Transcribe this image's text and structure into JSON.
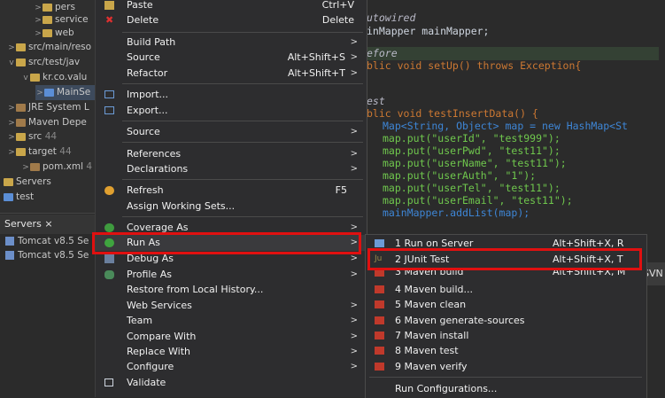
{
  "explorer": {
    "rows": [
      {
        "label": "pers",
        "prefix": ">"
      },
      {
        "label": "service",
        "prefix": ">"
      },
      {
        "label": "web",
        "prefix": ">"
      },
      {
        "label": "src/main/reso",
        "prefix": ">"
      },
      {
        "label": "src/test/jav",
        "prefix": "v"
      },
      {
        "label": "kr.co.valu",
        "prefix": "v"
      },
      {
        "label": "MainSe",
        "prefix": ">"
      },
      {
        "label": "JRE System L",
        "prefix": ">"
      },
      {
        "label": "Maven Depe",
        "prefix": ">"
      },
      {
        "label": "src",
        "prefix": ">",
        "suffix": "44"
      },
      {
        "label": "target",
        "prefix": ">",
        "suffix": "44"
      },
      {
        "label": "pom.xml",
        "prefix": ">",
        "suffix": "4"
      },
      {
        "label": "Servers",
        "prefix": ""
      },
      {
        "label": "test",
        "prefix": ""
      }
    ]
  },
  "servers_panel": {
    "tab_label": "Servers",
    "tab_close": "×",
    "rows": [
      "Tomcat v8.5 Se",
      "Tomcat v8.5 Se"
    ]
  },
  "editor": {
    "lines": [
      "utowired",
      "inMapper mainMapper;",
      "efore",
      "blic void setUp() throws Exception{",
      "est",
      "blic void testInsertData() {",
      "Map<String, Object> map = new HashMap<St",
      "map.put(\"userId\", \"test999\");",
      "map.put(\"userPwd\", \"test11\");",
      "map.put(\"userName\", \"test11\");",
      "map.put(\"userAuth\", \"1\");",
      "map.put(\"userTel\", \"test11\");",
      "map.put(\"userEmail\", \"test11\");",
      "mainMapper.addList(map);"
    ],
    "svn_tab": "SVN"
  },
  "context_menu": {
    "items": [
      {
        "label": "Paste",
        "key": "Ctrl+V",
        "icon": "paste-icon"
      },
      {
        "label": "Delete",
        "key": "Delete",
        "icon": "delete-icon"
      },
      {
        "label": "Build Path",
        "arrow": ">"
      },
      {
        "label": "Source",
        "key": "Alt+Shift+S",
        "arrow": ">"
      },
      {
        "label": "Refactor",
        "key": "Alt+Shift+T",
        "arrow": ">"
      },
      {
        "label": "Import...",
        "icon": "import-icon"
      },
      {
        "label": "Export...",
        "icon": "export-icon"
      },
      {
        "label": "Source",
        "arrow": ">"
      },
      {
        "label": "References",
        "arrow": ">"
      },
      {
        "label": "Declarations",
        "arrow": ">"
      },
      {
        "label": "Refresh",
        "key": "F5",
        "icon": "refresh-icon"
      },
      {
        "label": "Assign Working Sets..."
      },
      {
        "label": "Coverage As",
        "arrow": ">",
        "icon": "coverage-icon"
      },
      {
        "label": "Run As",
        "arrow": ">",
        "icon": "run-icon"
      },
      {
        "label": "Debug As",
        "arrow": ">",
        "icon": "debug-icon"
      },
      {
        "label": "Profile As",
        "arrow": ">",
        "icon": "profile-icon"
      },
      {
        "label": "Restore from Local History..."
      },
      {
        "label": "Web Services",
        "arrow": ">"
      },
      {
        "label": "Team",
        "arrow": ">"
      },
      {
        "label": "Compare With",
        "arrow": ">"
      },
      {
        "label": "Replace With",
        "arrow": ">"
      },
      {
        "label": "Configure",
        "arrow": ">"
      },
      {
        "label": "Validate",
        "icon": "validate-icon"
      }
    ]
  },
  "run_as_submenu": {
    "items": [
      {
        "label": "1 Run on Server",
        "key": "Alt+Shift+X, R",
        "icon": "server-run-icon"
      },
      {
        "label": "2 JUnit Test",
        "key": "Alt+Shift+X, T",
        "icon": "junit-icon"
      },
      {
        "label": "3 Maven build",
        "key": "Alt+Shift+X, M",
        "icon": "maven-icon"
      },
      {
        "label": "4 Maven build...",
        "icon": "maven-icon"
      },
      {
        "label": "5 Maven clean",
        "icon": "maven-icon"
      },
      {
        "label": "6 Maven generate-sources",
        "icon": "maven-icon"
      },
      {
        "label": "7 Maven install",
        "icon": "maven-icon"
      },
      {
        "label": "8 Maven test",
        "icon": "maven-icon"
      },
      {
        "label": "9 Maven verify",
        "icon": "maven-icon"
      },
      {
        "label": "Run Configurations..."
      }
    ]
  },
  "colors": {
    "highlight": "#e01010",
    "keyword": "#cc7832",
    "type": "#3e86d6",
    "string": "#6fc74d"
  }
}
